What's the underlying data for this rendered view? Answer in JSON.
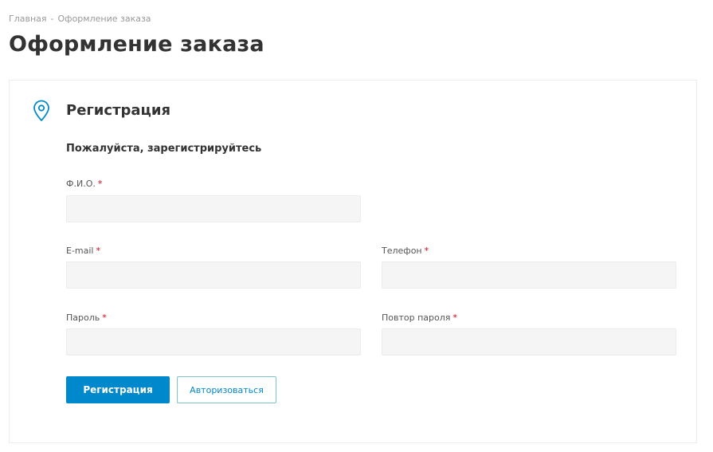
{
  "breadcrumb": {
    "home": "Главная",
    "separator": "-",
    "current": "Оформление заказа"
  },
  "page_title": "Оформление заказа",
  "section": {
    "title": "Регистрация",
    "icon": "map-pin-icon"
  },
  "form": {
    "subtitle": "Пожалуйста, зарегистрируйтесь",
    "required_mark": "*",
    "fields": {
      "fio": {
        "label": "Ф.И.О.",
        "value": "",
        "placeholder": ""
      },
      "email": {
        "label": "E-mail",
        "value": "",
        "placeholder": ""
      },
      "phone": {
        "label": "Телефон",
        "value": "",
        "placeholder": ""
      },
      "password": {
        "label": "Пароль",
        "value": "",
        "placeholder": ""
      },
      "password_repeat": {
        "label": "Повтор пароля",
        "value": "",
        "placeholder": ""
      }
    },
    "buttons": {
      "register": "Регистрация",
      "login": "Авторизоваться"
    }
  },
  "colors": {
    "accent": "#0088cc",
    "required": "#d0021b",
    "input_bg": "#f5f5f5"
  }
}
